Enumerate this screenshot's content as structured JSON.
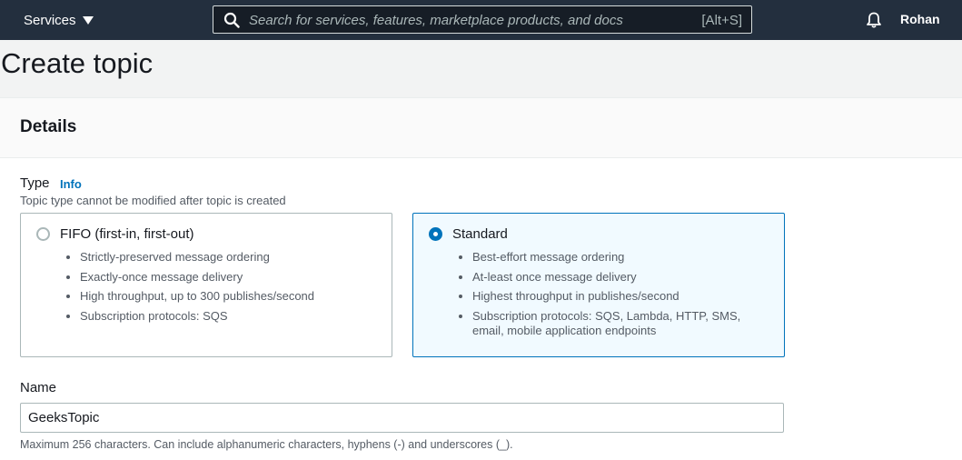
{
  "topnav": {
    "services_label": "Services",
    "search_placeholder": "Search for services, features, marketplace products, and docs",
    "search_shortcut": "[Alt+S]",
    "user_name": "Rohan"
  },
  "page": {
    "title": "Create topic"
  },
  "details": {
    "heading": "Details",
    "type": {
      "label": "Type",
      "info_link": "Info",
      "description": "Topic type cannot be modified after topic is created",
      "options": [
        {
          "title": "FIFO (first-in, first-out)",
          "selected": false,
          "features": [
            "Strictly-preserved message ordering",
            "Exactly-once message delivery",
            "High throughput, up to 300 publishes/second",
            "Subscription protocols: SQS"
          ]
        },
        {
          "title": "Standard",
          "selected": true,
          "features": [
            "Best-effort message ordering",
            "At-least once message delivery",
            "Highest throughput in publishes/second",
            "Subscription protocols: SQS, Lambda, HTTP, SMS, email, mobile application endpoints"
          ]
        }
      ]
    },
    "name": {
      "label": "Name",
      "value": "GeeksTopic",
      "hint": "Maximum 256 characters. Can include alphanumeric characters, hyphens (-) and underscores (_)."
    }
  },
  "colors": {
    "nav_background": "#232f3e",
    "accent": "#0073bb",
    "selected_tile_background": "#f1faff"
  }
}
